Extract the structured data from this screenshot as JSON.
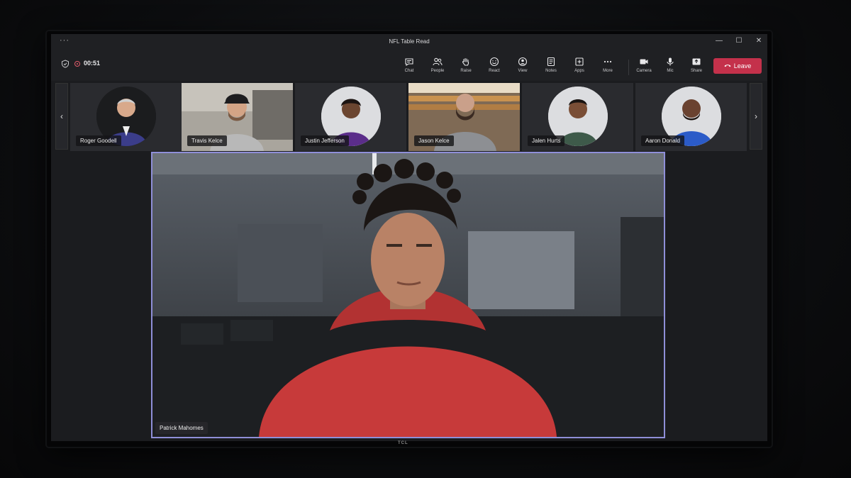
{
  "window": {
    "title": "NFL Table Read",
    "menu_dots": "···",
    "minimize": "—",
    "maximize": "☐",
    "close": "✕"
  },
  "meeting": {
    "timer": "00:51"
  },
  "toolbar": [
    {
      "label": "Chat",
      "icon": "chat-icon"
    },
    {
      "label": "People",
      "icon": "people-icon"
    },
    {
      "label": "Raise",
      "icon": "raise-hand-icon"
    },
    {
      "label": "React",
      "icon": "react-icon"
    },
    {
      "label": "View",
      "icon": "view-icon"
    },
    {
      "label": "Notes",
      "icon": "notes-icon"
    },
    {
      "label": "Apps",
      "icon": "apps-icon"
    },
    {
      "label": "More",
      "icon": "more-icon"
    },
    {
      "label": "Camera",
      "icon": "camera-icon"
    },
    {
      "label": "Mic",
      "icon": "mic-icon"
    },
    {
      "label": "Share",
      "icon": "share-icon"
    }
  ],
  "leave_label": "Leave",
  "participants": [
    {
      "name": "Roger Goodell",
      "style": "avatar",
      "shirt": "#3b3d8a"
    },
    {
      "name": "Travis Kelce",
      "style": "video",
      "shirt": "#b8b8b8"
    },
    {
      "name": "Justin Jefferson",
      "style": "avatar",
      "shirt": "#5b2d8a"
    },
    {
      "name": "Jason Kelce",
      "style": "video",
      "shirt": "#8d8f93"
    },
    {
      "name": "Jalen Hurts",
      "style": "avatar",
      "shirt": "#3e5a4a"
    },
    {
      "name": "Aaron Donald",
      "style": "avatar",
      "shirt": "#2b5bc8"
    }
  ],
  "nav": {
    "prev": "‹",
    "next": "›"
  },
  "main_speaker": {
    "name": "Patrick Mahomes"
  },
  "monitor_brand": "TCL",
  "colors": {
    "leave": "#c4314b",
    "active_border": "#8f8fd8",
    "hoodie": "#c73a3a"
  }
}
